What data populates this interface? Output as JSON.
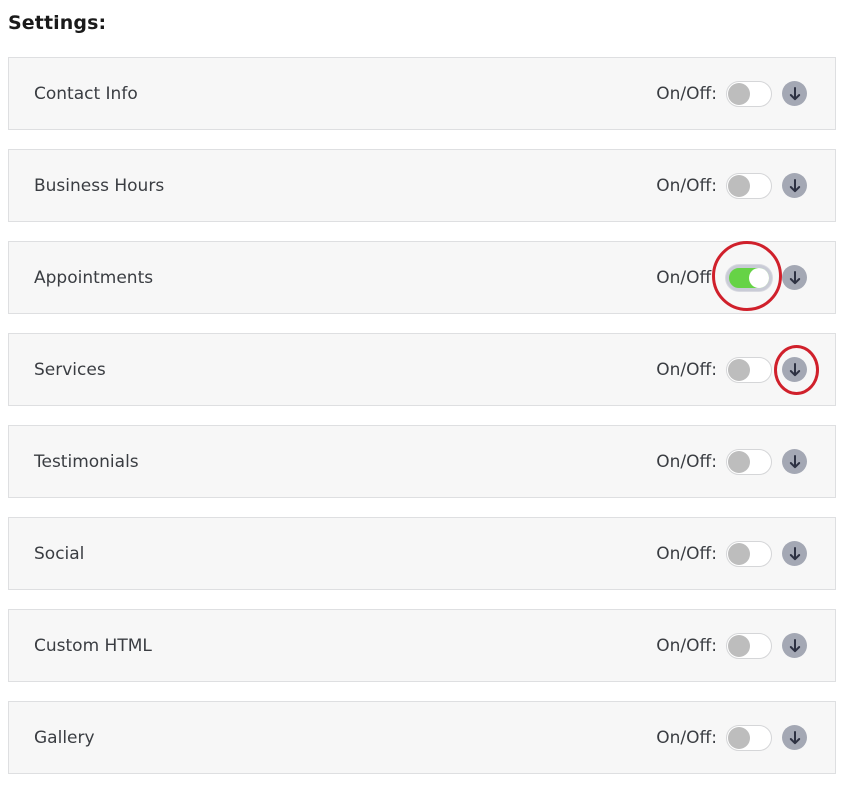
{
  "header": {
    "title": "Settings:"
  },
  "onoff_label": "On/Off:",
  "colors": {
    "toggle_on": "#66d346",
    "toggle_off_knob": "#bdbdbd",
    "expand_button": "#a4a8b4",
    "annotation": "#d0202b"
  },
  "settings": [
    {
      "label": "Contact Info",
      "enabled": false,
      "expand_icon": "arrow-down-icon"
    },
    {
      "label": "Business Hours",
      "enabled": false,
      "expand_icon": "arrow-down-icon"
    },
    {
      "label": "Appointments",
      "enabled": true,
      "expand_icon": "arrow-down-icon"
    },
    {
      "label": "Services",
      "enabled": false,
      "expand_icon": "arrow-down-icon"
    },
    {
      "label": "Testimonials",
      "enabled": false,
      "expand_icon": "arrow-down-icon"
    },
    {
      "label": "Social",
      "enabled": false,
      "expand_icon": "arrow-down-icon"
    },
    {
      "label": "Custom HTML",
      "enabled": false,
      "expand_icon": "arrow-down-icon"
    },
    {
      "label": "Gallery",
      "enabled": false,
      "expand_icon": "arrow-down-icon"
    }
  ],
  "annotations": [
    {
      "target": "Appointments toggle",
      "shape": "circle"
    },
    {
      "target": "Services expand button",
      "shape": "circle"
    }
  ]
}
